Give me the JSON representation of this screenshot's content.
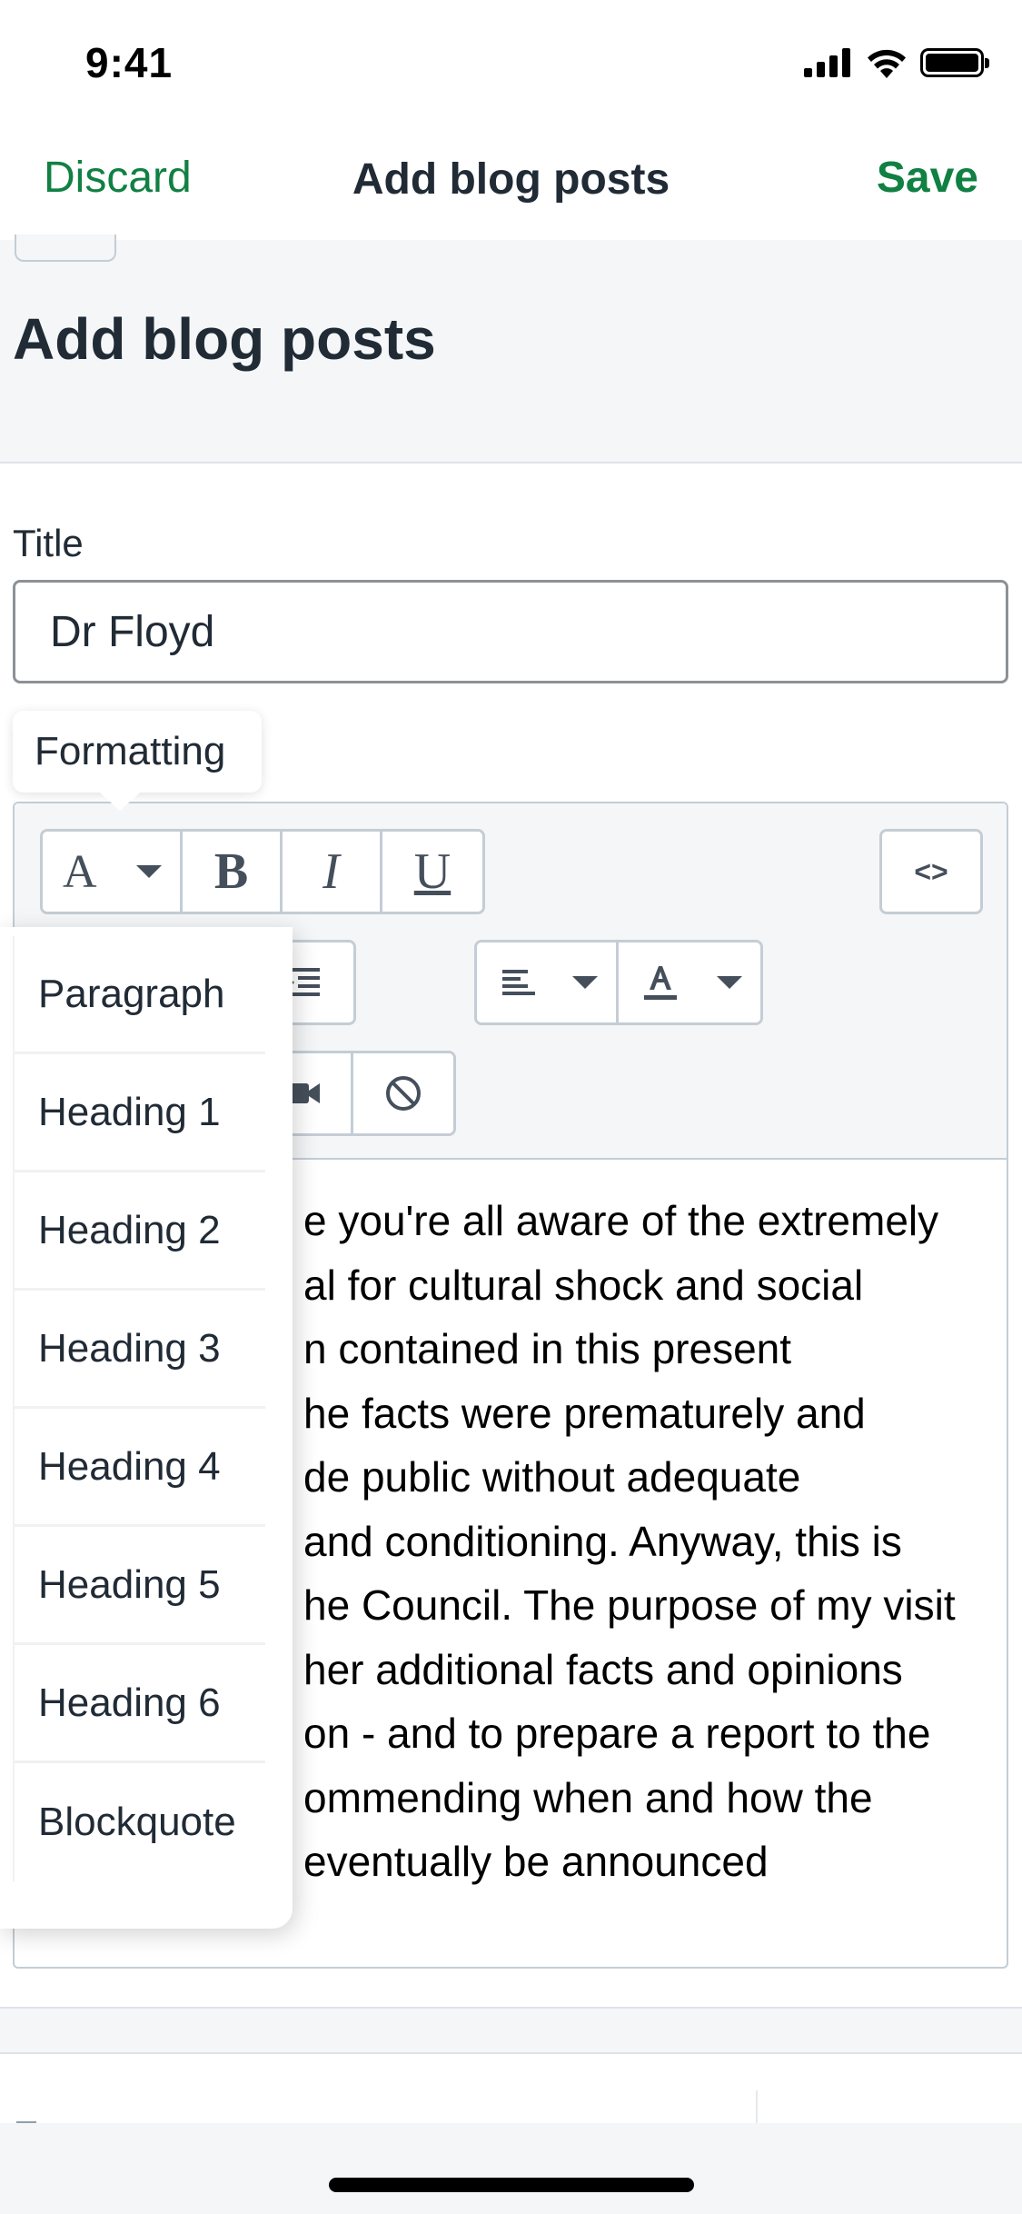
{
  "status_bar": {
    "time": "9:41"
  },
  "nav": {
    "discard_label": "Discard",
    "title": "Add blog posts",
    "save_label": "Save"
  },
  "page": {
    "title": "Add blog posts"
  },
  "form": {
    "title_label": "Title",
    "title_value": "Dr Floyd"
  },
  "tooltip": {
    "text": "Formatting"
  },
  "toolbar": {
    "format_button_label": "A",
    "bold_label": "B",
    "italic_label": "I",
    "underline_label": "U",
    "code_label": "<>"
  },
  "format_dropdown": {
    "items": [
      "Paragraph",
      "Heading 1",
      "Heading 2",
      "Heading 3",
      "Heading 4",
      "Heading 5",
      "Heading 6",
      "Blockquote"
    ]
  },
  "editor": {
    "lines": [
      "e you're all aware of the extremely",
      "al for cultural shock and social",
      "n contained in this present",
      "he facts were prematurely and",
      "de public without adequate",
      "and conditioning. Anyway, this is",
      "he Council. The purpose of my visit",
      "her additional facts and opinions",
      "on - and to prepare a report to the",
      "ommending when and how the",
      "eventually be announced"
    ]
  },
  "colors": {
    "accent": "#108043",
    "text": "#212b36",
    "border": "#c4cdd5",
    "background": "#f4f6f8"
  }
}
